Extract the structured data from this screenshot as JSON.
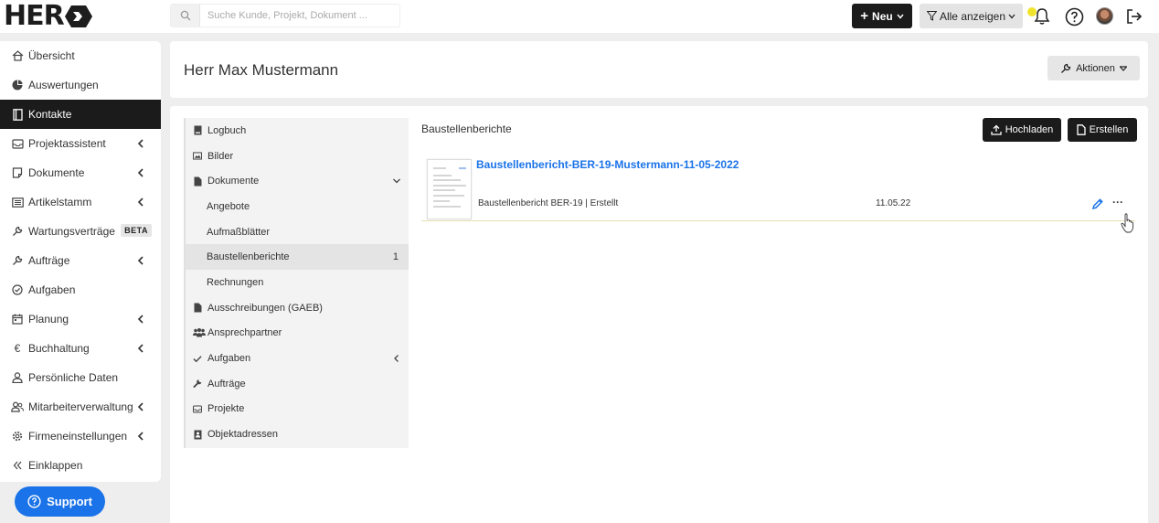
{
  "topbar": {
    "logo_text": "HER",
    "search_placeholder": "Suche Kunde, Projekt, Dokument ...",
    "new_label": "Neu",
    "filter_label": "Alle anzeigen"
  },
  "sidebar": {
    "items": [
      {
        "label": "Übersicht",
        "icon": "home-icon"
      },
      {
        "label": "Auswertungen",
        "icon": "pie-chart-icon"
      },
      {
        "label": "Kontakte",
        "icon": "address-book-icon",
        "active": true
      },
      {
        "label": "Projektassistent",
        "icon": "inbox-icon",
        "chevron": true
      },
      {
        "label": "Dokumente",
        "icon": "document-icon",
        "chevron": true
      },
      {
        "label": "Artikelstamm",
        "icon": "list-icon",
        "chevron": true
      },
      {
        "label": "Wartungsverträge",
        "icon": "wrench-icon",
        "badge": "BETA"
      },
      {
        "label": "Aufträge",
        "icon": "wrench-icon",
        "chevron": true
      },
      {
        "label": "Aufgaben",
        "icon": "check-circle-icon"
      },
      {
        "label": "Planung",
        "icon": "calendar-icon",
        "chevron": true
      },
      {
        "label": "Buchhaltung",
        "icon": "euro-icon",
        "chevron": true
      },
      {
        "label": "Persönliche Daten",
        "icon": "user-icon"
      },
      {
        "label": "Mitarbeiterverwaltung",
        "icon": "users-icon",
        "chevron": true
      },
      {
        "label": "Firmeneinstellungen",
        "icon": "gear-icon",
        "chevron": true
      },
      {
        "label": "Einklappen",
        "icon": "double-chevron-left-icon"
      }
    ],
    "support_label": "Support"
  },
  "header": {
    "title": "Herr Max Mustermann",
    "actions_label": "Aktionen"
  },
  "subnav": {
    "items": [
      {
        "label": "Logbuch",
        "icon": "book-icon"
      },
      {
        "label": "Bilder",
        "icon": "image-icon"
      },
      {
        "label": "Dokumente",
        "icon": "file-icon",
        "expanded": true
      },
      {
        "label": "Angebote",
        "child": true
      },
      {
        "label": "Aufmaßblätter",
        "child": true
      },
      {
        "label": "Baustellenberichte",
        "child": true,
        "active": true,
        "count": "1"
      },
      {
        "label": "Rechnungen",
        "child": true
      },
      {
        "label": "Ausschreibungen (GAEB)",
        "icon": "file-icon"
      },
      {
        "label": "Ansprechpartner",
        "icon": "users-icon"
      },
      {
        "label": "Aufgaben",
        "icon": "check-icon",
        "collapsible": true
      },
      {
        "label": "Aufträge",
        "icon": "wrench-icon"
      },
      {
        "label": "Projekte",
        "icon": "inbox-icon"
      },
      {
        "label": "Objektadressen",
        "icon": "contact-card-icon"
      }
    ]
  },
  "content": {
    "section_title": "Baustellenberichte",
    "upload_label": "Hochladen",
    "create_label": "Erstellen",
    "documents": [
      {
        "title": "Baustellenbericht-BER-19-Mustermann-11-05-2022",
        "meta": "Baustellenbericht BER-19 | Erstellt",
        "date": "11.05.22"
      }
    ]
  },
  "colors": {
    "accent": "#1a73e8",
    "dark": "#1b1b1b",
    "notification": "#f0e42c"
  }
}
